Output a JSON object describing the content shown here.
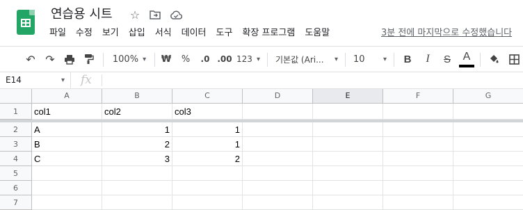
{
  "header": {
    "title": "연습용 시트",
    "menu": [
      "파일",
      "수정",
      "보기",
      "삽입",
      "서식",
      "데이터",
      "도구",
      "확장 프로그램",
      "도움말"
    ],
    "last_edit": "3분 전에 마지막으로 수정했습니다"
  },
  "toolbar": {
    "zoom": "100%",
    "currency": "₩",
    "percent": "%",
    "decrease_decimal": ".0",
    "increase_decimal": ".00",
    "more_formats": "123",
    "font": "기본값 (Ari...",
    "font_size": "10",
    "bold": "B",
    "italic": "I",
    "strike": "S",
    "text_color": "A"
  },
  "formula_bar": {
    "cell_ref": "E14",
    "fx": "fx",
    "value": ""
  },
  "sheet": {
    "columns": [
      "A",
      "B",
      "C",
      "D",
      "E",
      "F",
      "G"
    ],
    "rows": [
      "1",
      "2",
      "3",
      "4",
      "5",
      "6",
      "7"
    ],
    "cells": [
      [
        "col1",
        "col2",
        "col3",
        "",
        "",
        "",
        ""
      ],
      [
        "A",
        "1",
        "1",
        "",
        "",
        "",
        ""
      ],
      [
        "B",
        "2",
        "1",
        "",
        "",
        "",
        ""
      ],
      [
        "C",
        "3",
        "2",
        "",
        "",
        "",
        ""
      ],
      [
        "",
        "",
        "",
        "",
        "",
        "",
        ""
      ],
      [
        "",
        "",
        "",
        "",
        "",
        "",
        ""
      ],
      [
        "",
        "",
        "",
        "",
        "",
        "",
        ""
      ]
    ],
    "selected_column": "E"
  },
  "colors": {
    "brand_green": "#23a566",
    "header_bg": "#f8f9fa",
    "gridline": "#e2e3e3"
  }
}
